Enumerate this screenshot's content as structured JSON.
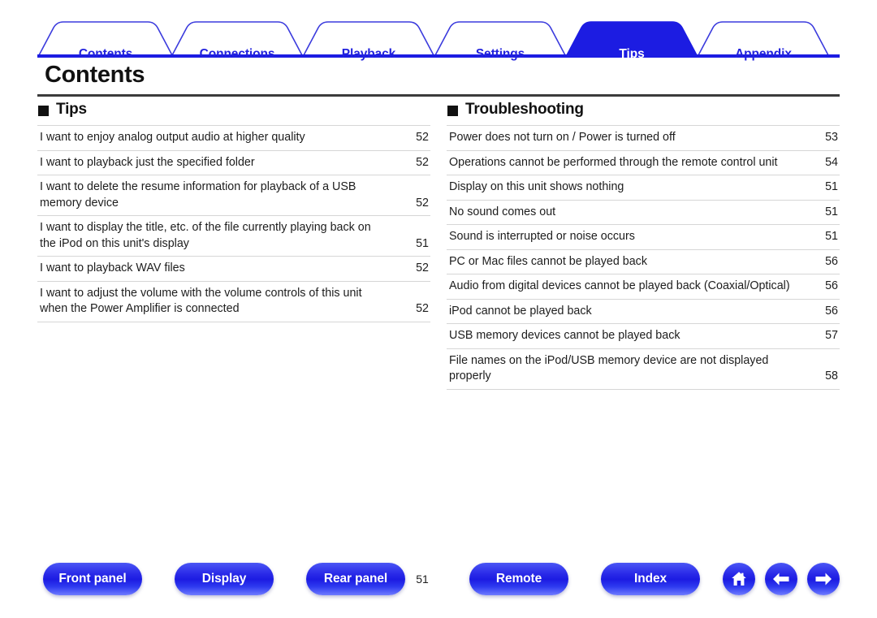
{
  "tabs": [
    {
      "label": "Contents",
      "active": false
    },
    {
      "label": "Connections",
      "active": false
    },
    {
      "label": "Playback",
      "active": false
    },
    {
      "label": "Settings",
      "active": false
    },
    {
      "label": "Tips",
      "active": true
    },
    {
      "label": "Appendix",
      "active": false
    }
  ],
  "page": {
    "title": "Contents",
    "number": "51"
  },
  "sections": [
    {
      "heading": "Tips",
      "entries": [
        {
          "text": "I want to enjoy analog output audio at higher quality",
          "page": "52"
        },
        {
          "text": "I want to playback just the specified folder",
          "page": "52"
        },
        {
          "text": "I want to delete the resume information for playback of a USB memory device",
          "page": "52"
        },
        {
          "text": "I want to display the title, etc. of the file currently playing back on the iPod on this unit's display",
          "page": "51"
        },
        {
          "text": "I want to playback WAV files",
          "page": "52"
        },
        {
          "text": "I want to adjust the volume with the volume controls of this unit when the Power Amplifier is connected",
          "page": "52"
        }
      ]
    },
    {
      "heading": "Troubleshooting",
      "entries": [
        {
          "text": "Power does not turn on / Power is turned off",
          "page": "53"
        },
        {
          "text": "Operations cannot be performed through the remote control unit",
          "page": "54"
        },
        {
          "text": "Display on this unit shows nothing",
          "page": "51"
        },
        {
          "text": "No sound comes out",
          "page": "51"
        },
        {
          "text": "Sound is interrupted or noise occurs",
          "page": "51"
        },
        {
          "text": "PC or Mac files cannot be played back",
          "page": "56"
        },
        {
          "text": "Audio from digital devices cannot be played back (Coaxial/Optical)",
          "page": "56"
        },
        {
          "text": "iPod cannot be played back",
          "page": "56"
        },
        {
          "text": "USB memory devices cannot be played back",
          "page": "57"
        },
        {
          "text": "File names on the iPod/USB memory device are not displayed properly",
          "page": "58"
        }
      ]
    }
  ],
  "footer": {
    "buttons": [
      {
        "label": "Front panel",
        "name": "front-panel"
      },
      {
        "label": "Display",
        "name": "display"
      },
      {
        "label": "Rear panel",
        "name": "rear-panel"
      },
      {
        "label": "Remote",
        "name": "remote"
      },
      {
        "label": "Index",
        "name": "index"
      }
    ],
    "icons": [
      {
        "icon": "home-icon"
      },
      {
        "icon": "arrow-left-icon"
      },
      {
        "icon": "arrow-right-icon"
      }
    ],
    "page_number": "51"
  },
  "colors": {
    "tab_blue": "#1c1ce2",
    "tab_text_blue": "#2222dd",
    "rule_dark": "#3b3b3b",
    "rule_light": "#d6d6d6"
  }
}
